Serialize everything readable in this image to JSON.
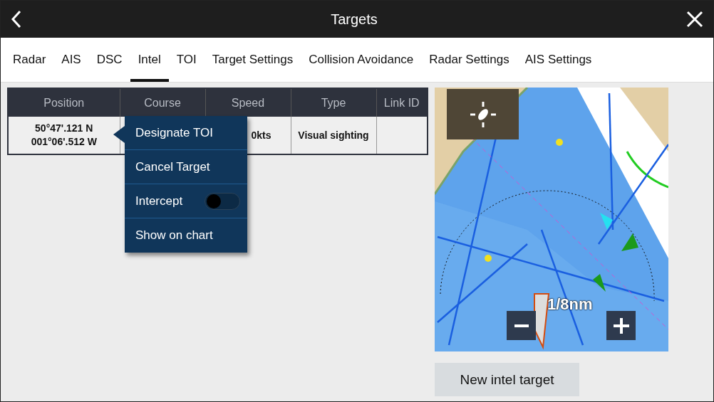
{
  "header": {
    "title": "Targets"
  },
  "tabs": [
    {
      "label": "Radar",
      "selected": false
    },
    {
      "label": "AIS",
      "selected": false
    },
    {
      "label": "DSC",
      "selected": false
    },
    {
      "label": "Intel",
      "selected": true
    },
    {
      "label": "TOI",
      "selected": false
    },
    {
      "label": "Target Settings",
      "selected": false
    },
    {
      "label": "Collision Avoidance",
      "selected": false
    },
    {
      "label": "Radar Settings",
      "selected": false
    },
    {
      "label": "AIS Settings",
      "selected": false
    }
  ],
  "table": {
    "columns": [
      "Position",
      "Course",
      "Speed",
      "Type",
      "Link ID"
    ],
    "rows": [
      {
        "position": [
          "50°47'.121 N",
          "001°06'.512 W"
        ],
        "speed": "0kts",
        "type": "Visual sighting"
      }
    ]
  },
  "context_menu": {
    "items": [
      {
        "kind": "action",
        "label": "Designate TOI"
      },
      {
        "kind": "action",
        "label": "Cancel Target"
      },
      {
        "kind": "toggle",
        "label": "Intercept",
        "on": false
      },
      {
        "kind": "action",
        "label": "Show on chart"
      }
    ]
  },
  "chart": {
    "scale": "1/8nm"
  },
  "buttons": [
    "New intel target"
  ]
}
